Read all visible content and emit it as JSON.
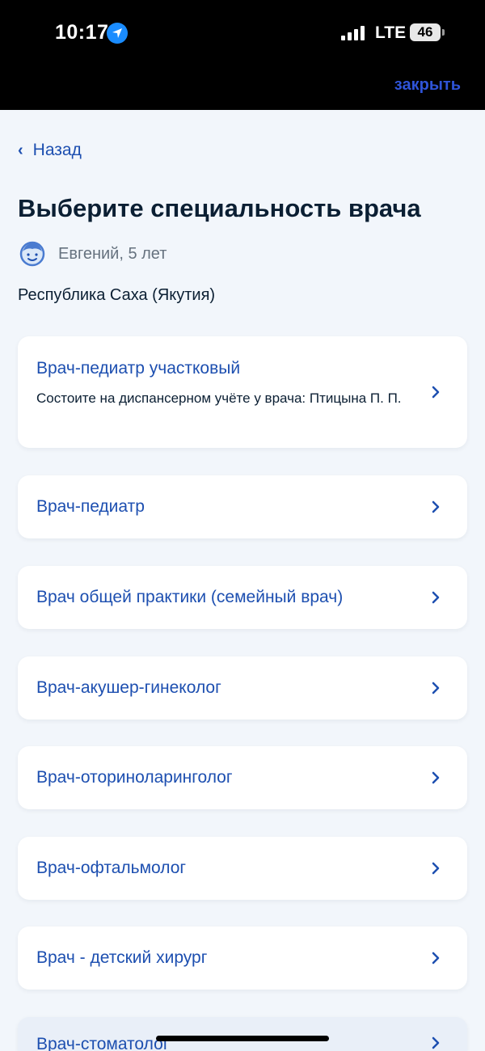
{
  "status_bar": {
    "time": "10:17",
    "network": "LTE",
    "battery": "46"
  },
  "header": {
    "close_label": "закрыть"
  },
  "nav": {
    "back_label": "Назад"
  },
  "page": {
    "title": "Выберите специальность врача",
    "patient": "Евгений, 5 лет",
    "region": "Республика Саха (Якутия)"
  },
  "specialties": [
    {
      "label": "Врач-педиатр участковый",
      "subtitle": "Состоите на диспансерном учёте у врача: Птицына П. П."
    },
    {
      "label": "Врач-педиатр"
    },
    {
      "label": "Врач общей практики (семейный врач)"
    },
    {
      "label": "Врач-акушер-гинеколог"
    },
    {
      "label": "Врач-оториноларинголог"
    },
    {
      "label": "Врач-офтальмолог"
    },
    {
      "label": "Врач - детский хирург"
    },
    {
      "label": "Врач-стоматолог"
    }
  ],
  "colors": {
    "accent": "#1d4fb0",
    "close_link": "#2f54d8",
    "background": "#f2f6fb",
    "text": "#0b1f33"
  }
}
